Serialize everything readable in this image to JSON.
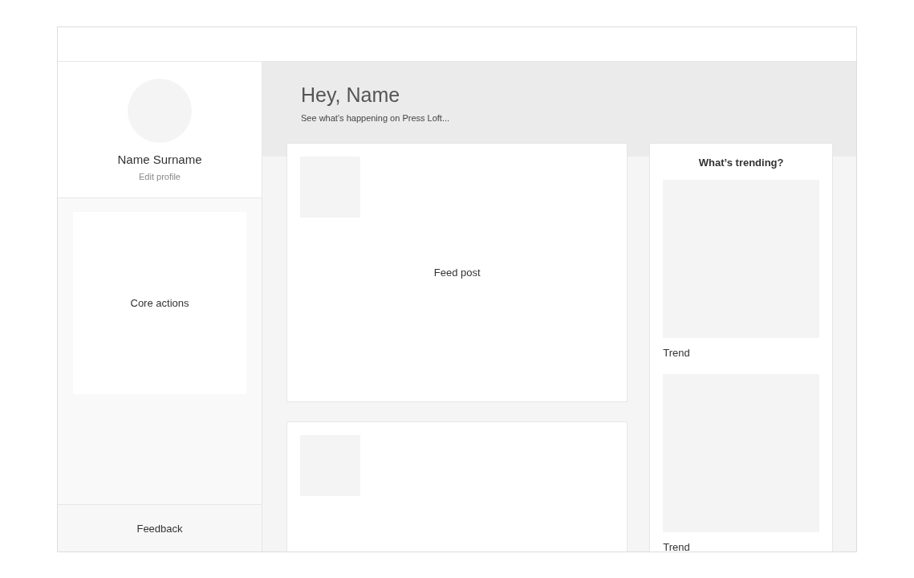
{
  "profile": {
    "name": "Name Surname",
    "link": "Edit profile"
  },
  "core_actions": {
    "label": "Core actions"
  },
  "feedback": {
    "label": "Feedback"
  },
  "header": {
    "title": "Hey, Name",
    "subtitle": "See what’s happening on Press Loft..."
  },
  "feed_posts": [
    {
      "kind": "post",
      "label": "Feed post"
    },
    {
      "kind": "post"
    }
  ],
  "trending": {
    "title": "What’s trending?",
    "items": [
      {
        "label": "Trend"
      },
      {
        "label": "Trend"
      }
    ]
  }
}
